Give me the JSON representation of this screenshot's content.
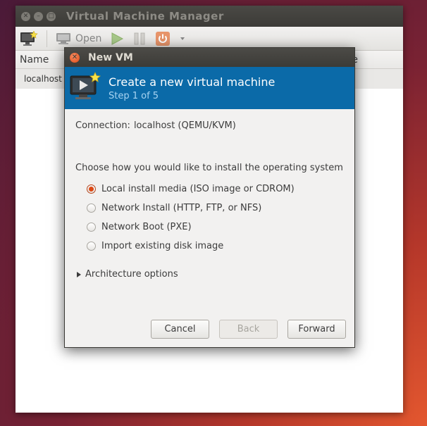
{
  "main_window": {
    "title": "Virtual Machine Manager",
    "toolbar": {
      "open_label": "Open"
    },
    "columns": {
      "name": "Name",
      "right_partial": "e"
    },
    "rows": [
      {
        "name": "localhost ("
      }
    ]
  },
  "dialog": {
    "title": "New VM",
    "header": {
      "title": "Create a new virtual machine",
      "step": "Step 1 of 5"
    },
    "connection": {
      "label": "Connection:",
      "value": "localhost (QEMU/KVM)"
    },
    "choose_label": "Choose how you would like to install the operating system",
    "options": [
      {
        "label": "Local install media (ISO image or CDROM)",
        "selected": true
      },
      {
        "label": "Network Install (HTTP, FTP, or NFS)",
        "selected": false
      },
      {
        "label": "Network Boot (PXE)",
        "selected": false
      },
      {
        "label": "Import existing disk image",
        "selected": false
      }
    ],
    "architecture_label": "Architecture options",
    "buttons": {
      "cancel": "Cancel",
      "back": "Back",
      "forward": "Forward"
    }
  },
  "colors": {
    "accent": "#dd4814",
    "header_blue": "#0b6aa8",
    "titlebar": "#3c3b37"
  }
}
